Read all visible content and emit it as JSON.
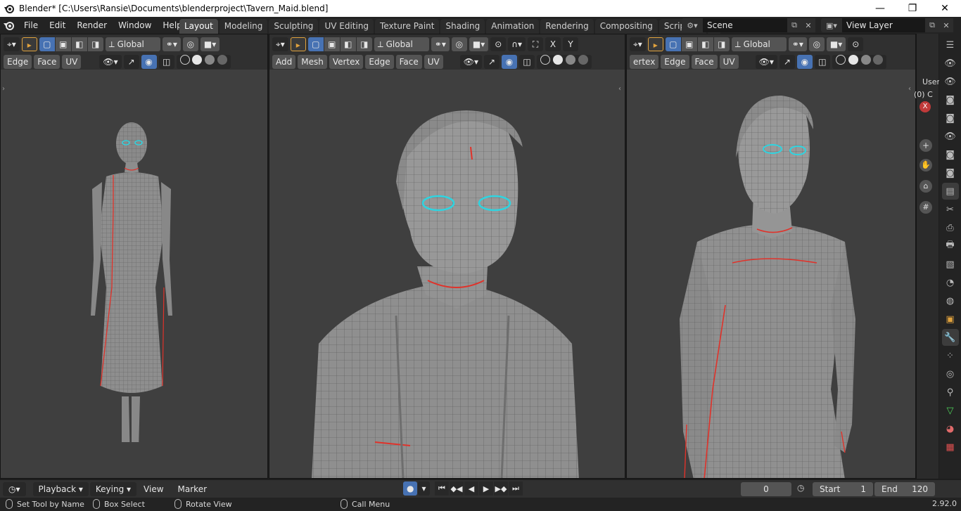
{
  "window": {
    "title": "Blender* [C:\\Users\\Ransie\\Documents\\blenderproject\\Tavern_Maid.blend]",
    "minimize_glyph": "—",
    "maximize_glyph": "❐",
    "close_glyph": "✕"
  },
  "menu": {
    "items": [
      "File",
      "Edit",
      "Render",
      "Window",
      "Help"
    ]
  },
  "workspace_tabs": {
    "items": [
      "Layout",
      "Modeling",
      "Sculpting",
      "UV Editing",
      "Texture Paint",
      "Shading",
      "Animation",
      "Rendering",
      "Compositing",
      "Scripting"
    ],
    "active": "Layout",
    "add_label": "+"
  },
  "scene": {
    "value": "Scene"
  },
  "view_layer": {
    "value": "View Layer"
  },
  "viewports": [
    {
      "orientation": "Global",
      "submodes": [
        "Edge",
        "Face",
        "UV"
      ]
    },
    {
      "orientation": "Global",
      "menus": [
        "Add",
        "Mesh",
        "Vertex",
        "Edge",
        "Face",
        "UV"
      ],
      "axis_x": "X",
      "axis_y": "Y"
    },
    {
      "orientation": "Global",
      "submodes": [
        "ertex",
        "Edge",
        "Face",
        "UV"
      ]
    }
  ],
  "sidebar_peek": {
    "line1": "User",
    "line2": "(0) C"
  },
  "timeline": {
    "playback": "Playback",
    "keying": "Keying",
    "view": "View",
    "marker": "Marker",
    "current_frame": "0",
    "start_label": "Start",
    "start_value": "1",
    "end_label": "End",
    "end_value": "120"
  },
  "statusbar": {
    "set_tool": "Set Tool by Name",
    "box_select": "Box Select",
    "rotate_view": "Rotate View",
    "call_menu": "Call Menu",
    "version": "2.92.0"
  },
  "colors": {
    "accent_blue": "#4772b3",
    "seam_red": "#e0322a",
    "selection_cyan": "#2fd4e0",
    "viewport_bg": "#3f3f3f"
  }
}
